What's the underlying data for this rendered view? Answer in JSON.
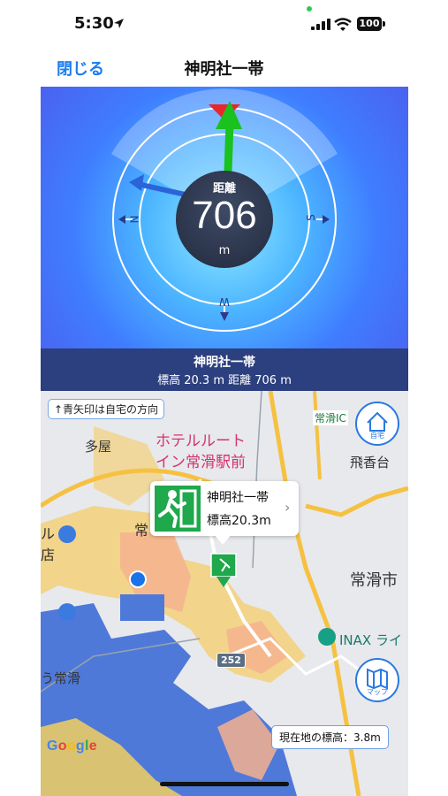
{
  "status_bar": {
    "time": "5:30",
    "battery": "100",
    "location_icon": "location-arrow-icon",
    "signal_icon": "cellular-signal-icon",
    "wifi_icon": "wifi-icon"
  },
  "nav": {
    "close_label": "閉じる",
    "title": "神明社一帯"
  },
  "compass": {
    "distance_label": "距離",
    "distance_value": "706",
    "distance_unit": "m",
    "cardinal_labels": [
      "N",
      "S",
      "W"
    ],
    "target_arrow_color": "#19c21f",
    "home_arrow_color": "#2b63d9",
    "north_marker_color": "#e8262c"
  },
  "info_bar": {
    "name": "神明社一帯",
    "detail": "標高 20.3 m  距離 706 m"
  },
  "map": {
    "direction_hint": "↑青矢印は自宅の方向",
    "home_button_label": "自宅",
    "map_button_label": "マップ",
    "labels": {
      "ic": "常滑IC",
      "tabitodai": "飛香台",
      "tajiya": "多屋",
      "hotel_line1": "ホテルルート",
      "hotel_line2": "イン常滑駅前",
      "tokoname_city": "常滑市",
      "inax": "INAX ライ",
      "tokoname_station": "う常滑",
      "tokoname_short": "常",
      "left_edge_1": "ル",
      "left_edge_2": "店",
      "route": "252"
    },
    "callout": {
      "name": "神明社一帯",
      "elevation": "標高20.3m",
      "icon": "emergency-exit-icon"
    },
    "current_elevation": "現在地の標高：3.8m",
    "google": [
      "G",
      "o",
      "o",
      "g",
      "l",
      "e"
    ],
    "google_colors": [
      "#4285f4",
      "#ea4335",
      "#fbbc05",
      "#4285f4",
      "#34a853",
      "#ea4335"
    ],
    "current_location_color": "#1a73e8"
  }
}
